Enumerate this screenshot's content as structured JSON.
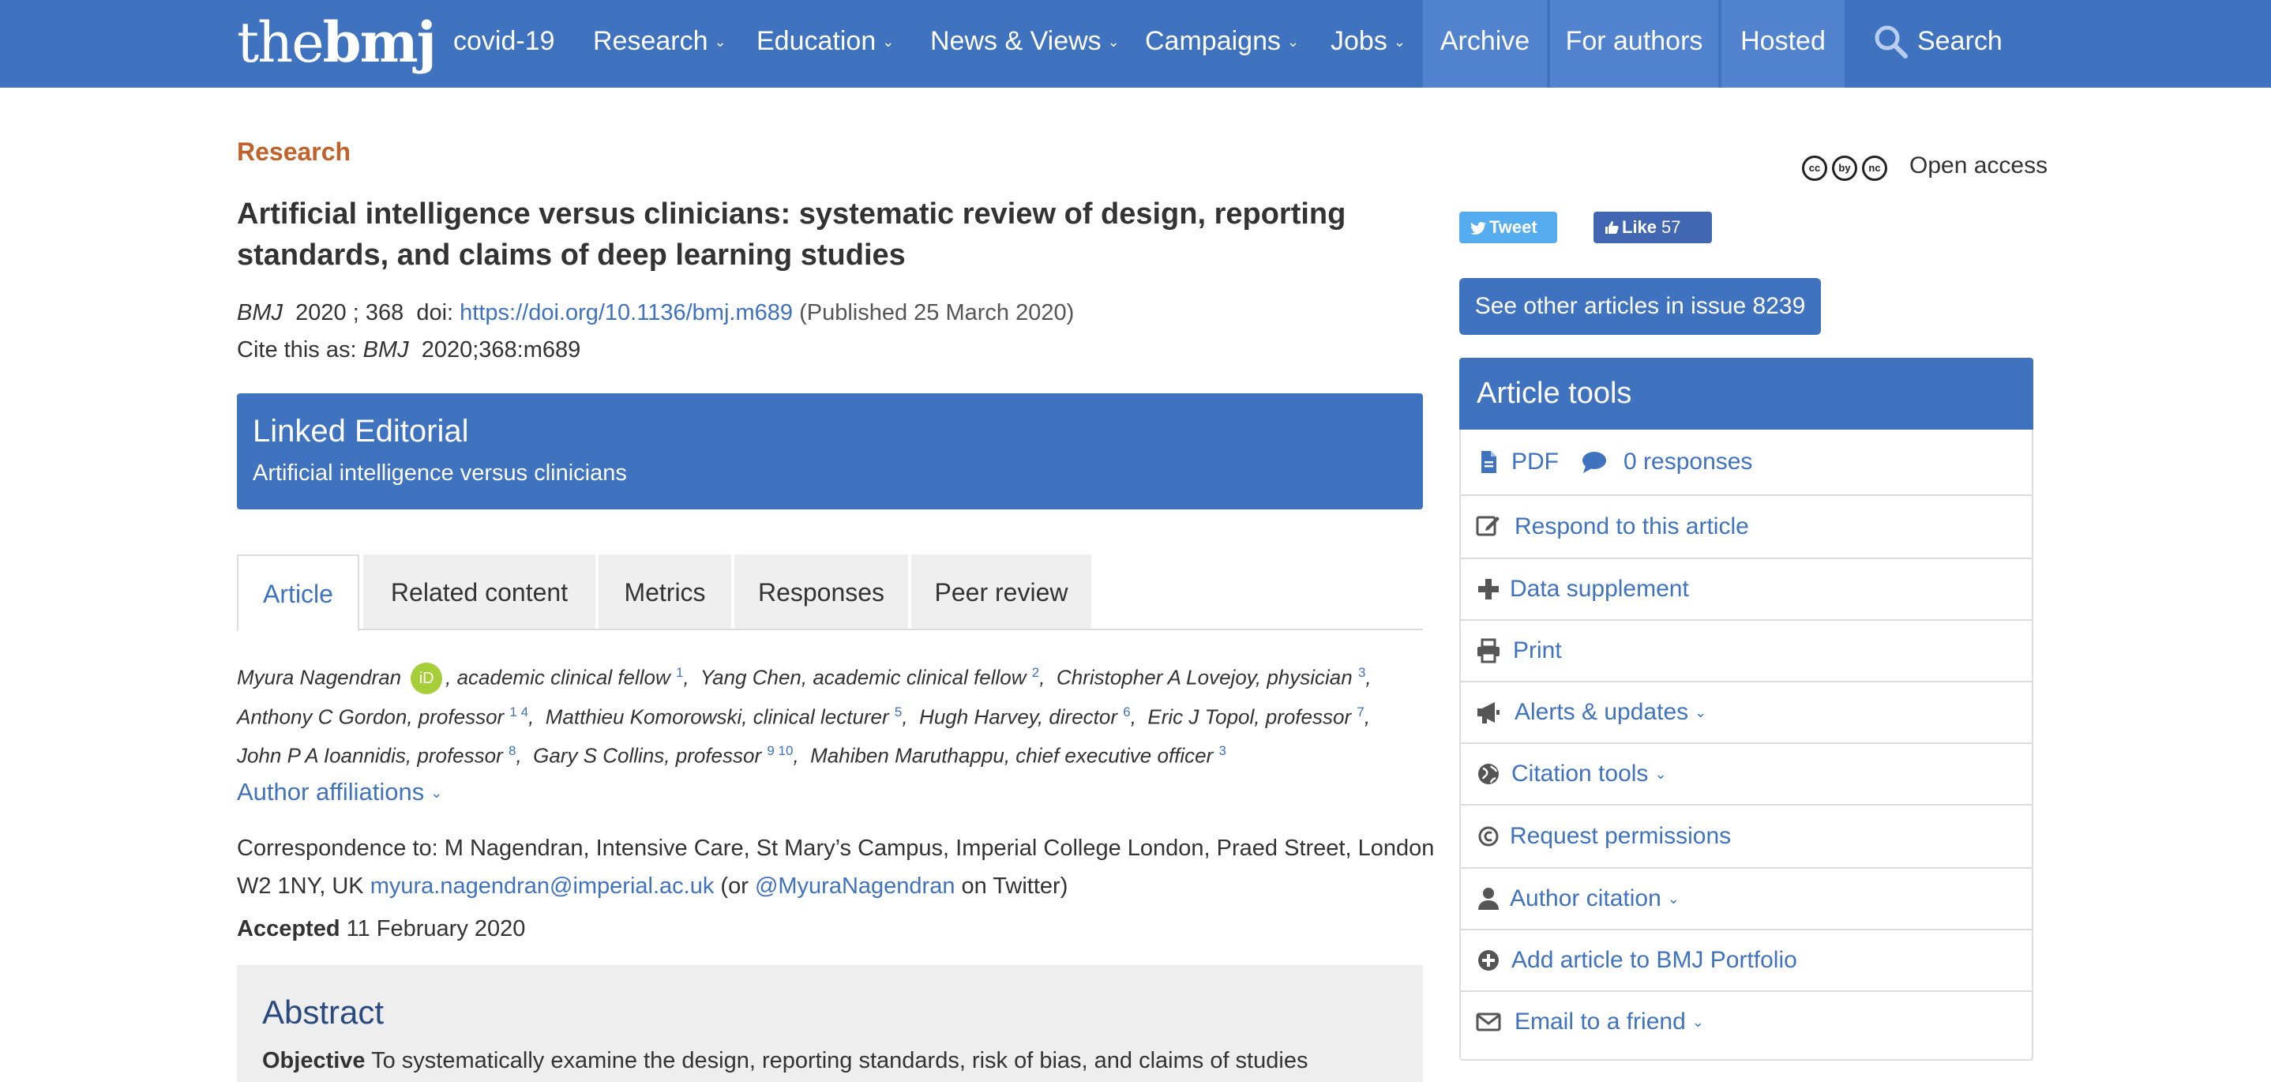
{
  "brand": {
    "logo_thin": "the",
    "logo_bold": "bmj",
    "color": "#3f72bf"
  },
  "nav": {
    "items": [
      {
        "label": "covid-19"
      },
      {
        "label": "Research",
        "chevron": "⌄"
      },
      {
        "label": "Education",
        "chevron": "⌄"
      },
      {
        "label": "News & Views",
        "chevron": "⌄"
      },
      {
        "label": "Campaigns",
        "chevron": "⌄"
      },
      {
        "label": "Jobs",
        "chevron": "⌄"
      }
    ],
    "boxes": [
      {
        "label": "Archive"
      },
      {
        "label": "For authors"
      },
      {
        "label": "Hosted"
      }
    ],
    "search_label": "Search"
  },
  "article": {
    "section": "Research",
    "title": "Artificial intelligence versus clinicians: systematic review of design, reporting standards, and claims of deep learning studies",
    "journal": "BMJ",
    "year": "2020",
    "volume": "; 368",
    "doi_label": "doi:",
    "doi": "https://doi.org/10.1136/bmj.m689",
    "published": "(Published 25 March 2020)",
    "cite_label": "Cite this as:",
    "cite_journal": "BMJ",
    "cite_ref": "2020;368:m689"
  },
  "linked_editorial": {
    "title": "Linked Editorial",
    "subtitle": "Artificial intelligence versus clinicians"
  },
  "tabs": [
    {
      "label": "Article",
      "active": true
    },
    {
      "label": "Related content"
    },
    {
      "label": "Metrics"
    },
    {
      "label": "Responses"
    },
    {
      "label": "Peer review"
    }
  ],
  "authors": {
    "orcid_label": "iD",
    "list": [
      {
        "name": "Myura Nagendran",
        "role": "",
        "sup": ""
      },
      {
        "name": "",
        "role": ", academic clinical fellow",
        "sup": "1"
      },
      {
        "name": "Yang Chen",
        "role": ", academic clinical fellow",
        "sup": "2"
      },
      {
        "name": "Christopher A Lovejoy",
        "role": ", physician",
        "sup": "3"
      },
      {
        "name": "Anthony C Gordon",
        "role": ", professor",
        "sup": "1  4"
      },
      {
        "name": "Matthieu Komorowski",
        "role": ", clinical lecturer",
        "sup": "5"
      },
      {
        "name": "Hugh Harvey",
        "role": ", director",
        "sup": "6"
      },
      {
        "name": "Eric J Topol",
        "role": ", professor",
        "sup": "7"
      },
      {
        "name": "John P A Ioannidis",
        "role": ", professor",
        "sup": "8"
      },
      {
        "name": "Gary S Collins",
        "role": ", professor",
        "sup": "9  10"
      },
      {
        "name": "Mahiben Maruthappu",
        "role": ", chief executive officer",
        "sup": "3"
      }
    ]
  },
  "affiliations": {
    "label": "Author affiliations",
    "chevron": "⌄"
  },
  "correspondence": {
    "prefix": "Correspondence to: M Nagendran, Intensive Care, St Mary’s Campus, Imperial College London, Praed Street, London W2 1NY, UK",
    "email": "myura.nagendran@imperial.ac.uk",
    "mid": "(or",
    "twitter": "@MyuraNagendran",
    "suffix": "on Twitter)"
  },
  "accepted": {
    "label": "Accepted",
    "date": "11 February 2020"
  },
  "abstract": {
    "title": "Abstract",
    "objective_label": "Objective",
    "objective_text": "To systematically examine the design, reporting standards, risk of bias, and claims of studies"
  },
  "sidebar": {
    "cc_icons": [
      "cc",
      "by",
      "nc"
    ],
    "open_access": "Open access",
    "tweet": "Tweet",
    "like": "Like",
    "like_count": "57",
    "issue_button": "See other articles in issue 8239",
    "tools_title": "Article tools",
    "pdf": "PDF",
    "responses": "0 responses",
    "tools": [
      {
        "label": "Respond to this article",
        "icon": "edit-icon"
      },
      {
        "label": "Data supplement",
        "icon": "plus-icon"
      },
      {
        "label": "Print",
        "icon": "print-icon"
      },
      {
        "label": "Alerts & updates",
        "icon": "megaphone-icon",
        "chevron": "⌄"
      },
      {
        "label": "Citation tools",
        "icon": "globe-icon",
        "chevron": "⌄"
      },
      {
        "label": "Request permissions",
        "icon": "copyright-icon"
      },
      {
        "label": "Author citation",
        "icon": "user-icon",
        "chevron": "⌄"
      },
      {
        "label": "Add article to BMJ Portfolio",
        "icon": "plus-circle-icon"
      },
      {
        "label": "Email to a friend",
        "icon": "envelope-icon",
        "chevron": "⌄"
      }
    ]
  }
}
